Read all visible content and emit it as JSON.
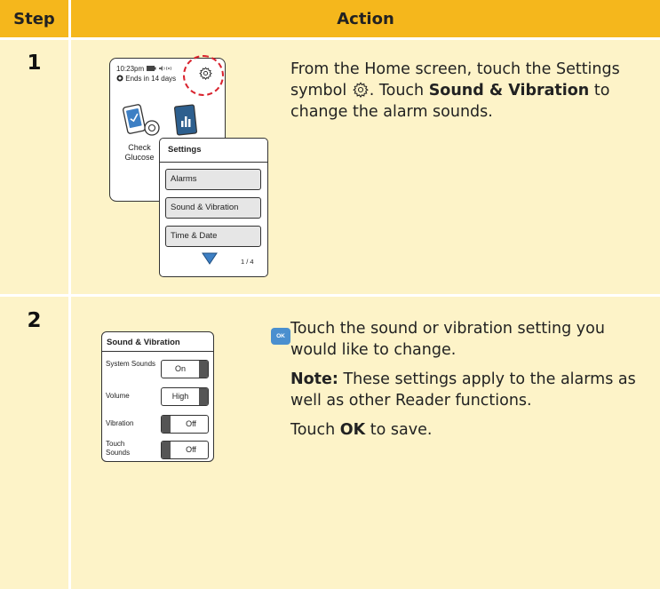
{
  "header": {
    "step": "Step",
    "action": "Action"
  },
  "steps": [
    {
      "number": "1",
      "text_before_icon": "From the Home screen, touch the Settings symbol ",
      "text_after_icon": ". Touch ",
      "bold": "Sound & Vibration",
      "text_end": " to change the alarm sounds.",
      "illustration": {
        "status_time": "10:23pm",
        "status_ends": "Ends in 14 days",
        "check_label": "Check Glucose",
        "settings_title": "Settings",
        "menu_items": [
          "Alarms",
          "Sound & Vibration",
          "Time & Date"
        ],
        "pager": "1 / 4",
        "highlight_color": "#d9232e"
      }
    },
    {
      "number": "2",
      "para1": "Touch the sound or vibration setting you would like to change.",
      "note_label": "Note:",
      "note_text": " These settings apply to the alarms as well as other Reader functions.",
      "save_before": "Touch ",
      "save_bold": "OK",
      "save_after": " to save.",
      "illustration": {
        "title": "Sound & Vibration",
        "ok": "OK",
        "rows": [
          {
            "label": "System Sounds",
            "value": "On"
          },
          {
            "label": "Volume",
            "value": "High"
          },
          {
            "label": "Vibration",
            "value": "Off"
          },
          {
            "label": "Touch Sounds",
            "value": "Off"
          }
        ]
      }
    }
  ],
  "colors": {
    "header": "#f5b71c",
    "cell": "#fdf3c8",
    "ok_button": "#4a8fcf"
  }
}
